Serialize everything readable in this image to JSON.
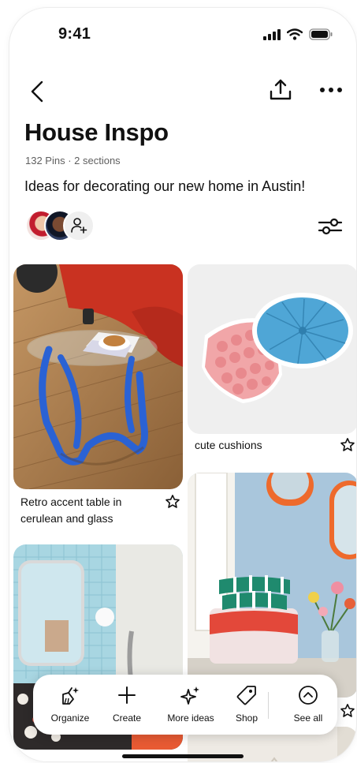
{
  "status_bar": {
    "time": "9:41"
  },
  "board": {
    "title": "House Inspo",
    "meta": "132 Pins · 2 sections",
    "description": "Ideas for decorating our new home in Austin!"
  },
  "pins": {
    "retro_table": {
      "caption_line1": "Retro accent table in",
      "caption_line2": "cerulean and glass"
    },
    "cushions": {
      "caption": "cute cushions"
    }
  },
  "toolbar": {
    "organize": "Organize",
    "create": "Create",
    "more_ideas": "More ideas",
    "shop": "Shop",
    "see_all": "See all"
  },
  "colors": {
    "accent_blue": "#2a62d4",
    "couch_red": "#d5402b",
    "mirror_orange": "#ee6a2c",
    "tile_blue": "#a8d6e2"
  }
}
